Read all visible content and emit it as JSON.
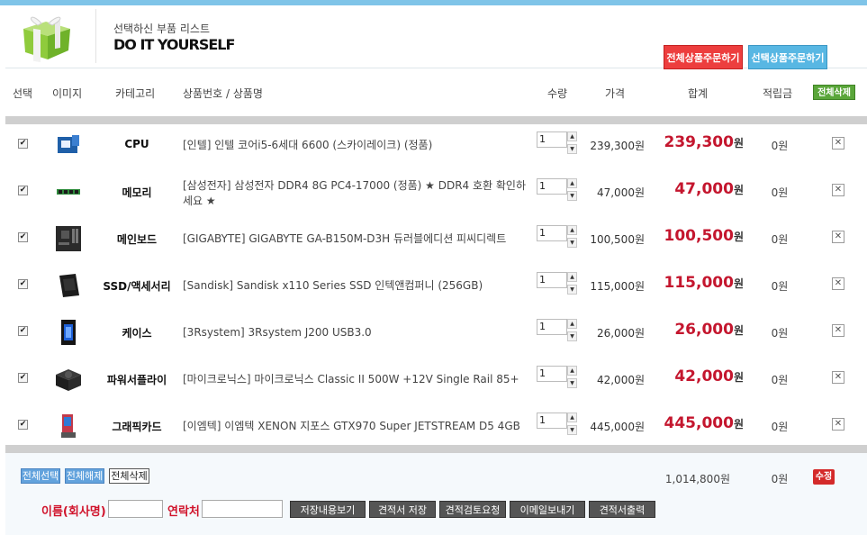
{
  "header": {
    "subtitle": "선택하신 부품 리스트",
    "title": "DO IT YOURSELF"
  },
  "columns": {
    "select": "선택",
    "image": "이미지",
    "category": "카테고리",
    "product": "상품번호 / 상품명",
    "qty": "수량",
    "price": "가격",
    "total": "합계",
    "points": "적립금",
    "delete_all": "전체삭제"
  },
  "rows": [
    {
      "category": "CPU",
      "name": "[인텔] 인텔 코어i5-6세대 6600 (스카이레이크) (정품)",
      "qty": "1",
      "price": "239,300원",
      "total": "239,300",
      "unit": "원",
      "points": "0원",
      "icon": "cpu-box-icon"
    },
    {
      "category": "메모리",
      "name": "[삼성전자] 삼성전자 DDR4 8G PC4-17000 (정품) ★ DDR4 호환 확인하세요 ★",
      "qty": "1",
      "price": "47,000원",
      "total": "47,000",
      "unit": "원",
      "points": "0원",
      "icon": "memory-stick-icon"
    },
    {
      "category": "메인보드",
      "name": "[GIGABYTE] GIGABYTE GA-B150M-D3H 듀러블에디션 피씨디렉트",
      "qty": "1",
      "price": "100,500원",
      "total": "100,500",
      "unit": "원",
      "points": "0원",
      "icon": "mainboard-icon"
    },
    {
      "category": "SSD/액세서리",
      "name": "[Sandisk] Sandisk x110 Series SSD 인텍앤컴퍼니 (256GB)",
      "qty": "1",
      "price": "115,000원",
      "total": "115,000",
      "unit": "원",
      "points": "0원",
      "icon": "ssd-icon"
    },
    {
      "category": "케이스",
      "name": "[3Rsystem] 3Rsystem J200 USB3.0",
      "qty": "1",
      "price": "26,000원",
      "total": "26,000",
      "unit": "원",
      "points": "0원",
      "icon": "pc-case-icon"
    },
    {
      "category": "파워서플라이",
      "name": "[마이크로닉스] 마이크로닉스 Classic II 500W +12V Single Rail 85+",
      "qty": "1",
      "price": "42,000원",
      "total": "42,000",
      "unit": "원",
      "points": "0원",
      "icon": "power-supply-icon"
    },
    {
      "category": "그래픽카드",
      "name": "[이엠텍] 이엠텍 XENON 지포스 GTX970 Super JETSTREAM D5 4GB",
      "qty": "1",
      "price": "445,000원",
      "total": "445,000",
      "unit": "원",
      "points": "0원",
      "icon": "graphics-card-icon"
    }
  ],
  "footer": {
    "select_all": "전체선택",
    "deselect_all": "전체해제",
    "delete_all": "전체삭제",
    "sum_total": "1,014,800원",
    "sum_points": "0원",
    "edit": "수정",
    "name_label": "이름(회사명)",
    "contact_label": "연락처",
    "btn_view_saved": "저장내용보기",
    "btn_save_quote": "견적서 저장",
    "btn_review": "견적검토요청",
    "btn_email": "이메일보내기",
    "btn_print": "견적서출력",
    "btn_order_all": "전체상품주문하기",
    "btn_order_selected": "선택상품주문하기"
  },
  "colors": {
    "accent_red": "#c4162e",
    "delete_all_green": "#5aa63a",
    "order_red": "#ed3e3e",
    "order_blue": "#58b7e3",
    "top_bar": "#7fc4e8"
  }
}
